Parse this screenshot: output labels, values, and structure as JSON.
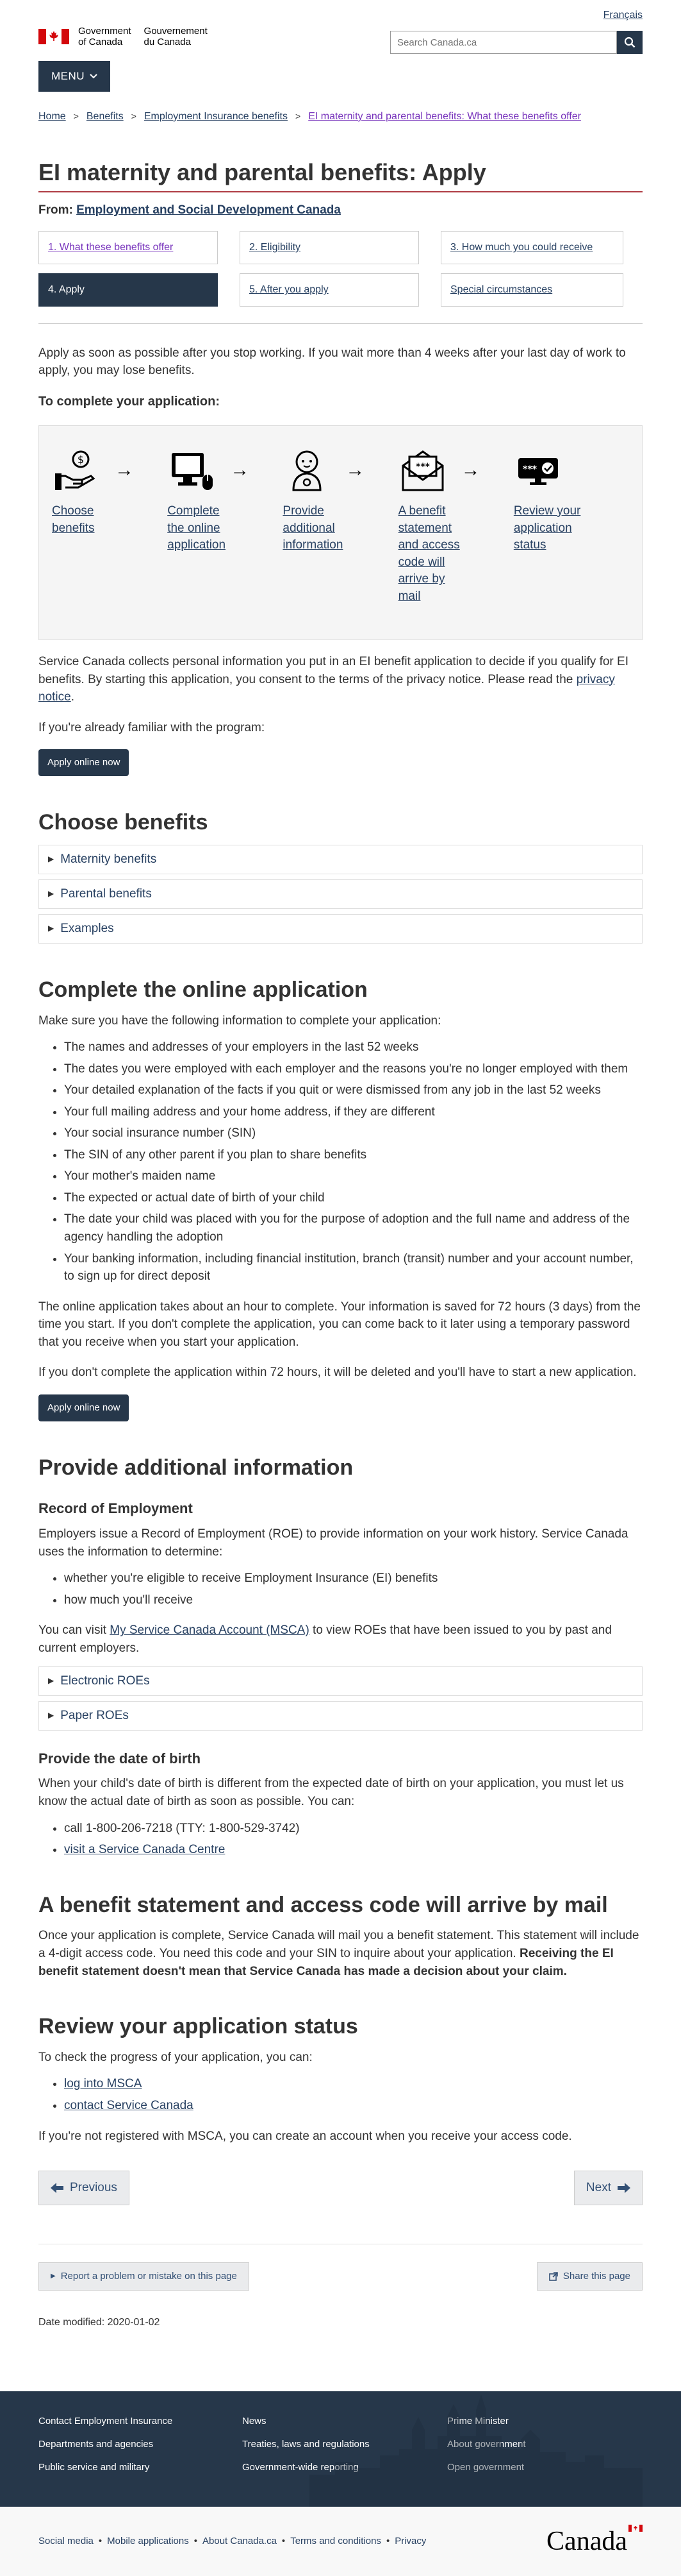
{
  "header": {
    "language_link": "Français",
    "sig_en_line1": "Government",
    "sig_en_line2": "of Canada",
    "sig_fr_line1": "Gouvernement",
    "sig_fr_line2": "du Canada",
    "search_placeholder": "Search Canada.ca",
    "menu_label": "MENU"
  },
  "breadcrumb": [
    "Home",
    "Benefits",
    "Employment Insurance benefits",
    "EI maternity and parental benefits: What these benefits offer"
  ],
  "page_title": "EI maternity and parental benefits: Apply",
  "from_label": "From: ",
  "from_link": "Employment and Social Development Canada",
  "steps": [
    {
      "label": "1. What these benefits offer",
      "active": false
    },
    {
      "label": "2. Eligibility",
      "active": false
    },
    {
      "label": "3. How much you could receive",
      "active": false
    },
    {
      "label": "4. Apply",
      "active": true
    },
    {
      "label": "5. After you apply",
      "active": false
    },
    {
      "label": "Special circumstances",
      "active": false
    }
  ],
  "intro": "Apply as soon as possible after you stop working. If you wait more than 4 weeks after your last day of work to apply, you may lose benefits.",
  "complete_heading": "To complete your application:",
  "process": [
    {
      "icon": "hand-coin-icon",
      "label": "Choose benefits"
    },
    {
      "icon": "computer-mouse-icon",
      "label": "Complete the online application"
    },
    {
      "icon": "baby-icon",
      "label": "Provide additional information"
    },
    {
      "icon": "envelope-icon",
      "label": "A benefit statement and access code will arrive by mail"
    },
    {
      "icon": "status-check-icon",
      "label": "Review your application status"
    }
  ],
  "privacy_text_1": "Service Canada collects personal information you put in an EI benefit application to decide if you qualify for EI benefits. By starting this application, you consent to the terms of the privacy notice. Please read the ",
  "privacy_link": "privacy notice",
  "privacy_text_2": ".",
  "familiar": "If you're already familiar with the program:",
  "apply_button": "Apply online now",
  "choose": {
    "heading": "Choose benefits",
    "items": [
      "Maternity benefits",
      "Parental benefits",
      "Examples"
    ]
  },
  "online": {
    "heading": "Complete the online application",
    "intro": "Make sure you have the following information to complete your application:",
    "list": [
      "The names and addresses of your employers in the last 52 weeks",
      "The dates you were employed with each employer and the reasons you're no longer employed with them",
      "Your detailed explanation of the facts if you quit or were dismissed from any job in the last 52 weeks",
      "Your full mailing address and your home address, if they are different",
      "Your social insurance number (SIN)",
      "The SIN of any other parent if you plan to share benefits",
      "Your mother's maiden name",
      "The expected or actual date of birth of your child",
      "The date your child was placed with you for the purpose of adoption and the full name and address of the agency handling the adoption",
      "Your banking information, including financial institution, branch (transit) number and your account number, to sign up for direct deposit"
    ],
    "para1": "The online application takes about an hour to complete. Your information is saved for 72 hours (3 days) from the time you start. If you don't complete the application, you can come back to it later using a temporary password that you receive when you start your application.",
    "para2": "If you don't complete the application within 72 hours, it will be deleted and you'll have to start a new application."
  },
  "additional": {
    "heading": "Provide additional information",
    "roe_heading": "Record of Employment",
    "roe_text": "Employers issue a Record of Employment (ROE) to provide information on your work history. Service Canada uses the information to determine:",
    "roe_list": [
      "whether you're eligible to receive Employment Insurance (EI) benefits",
      "how much you'll receive"
    ],
    "msca_1": "You can visit ",
    "msca_link": "My Service Canada Account (MSCA)",
    "msca_2": " to view ROEs that have been issued to you by past and current employers.",
    "roe_details": [
      "Electronic ROEs",
      "Paper ROEs"
    ],
    "dob_heading": "Provide the date of birth",
    "dob_text": "When your child's date of birth is different from the expected date of birth on your application, you must let us know the actual date of birth as soon as possible. You can:",
    "dob_call": "call 1-800-206-7218 (TTY: 1-800-529-3742)",
    "dob_visit": "visit a Service Canada Centre"
  },
  "mail": {
    "heading": "A benefit statement and access code will arrive by mail",
    "text": "Once your application is complete, Service Canada will mail you a benefit statement. This statement will include a 4-digit access code. You need this code and your SIN to inquire about your application.",
    "bold": "Receiving the EI benefit statement doesn't mean that Service Canada has made a decision about your claim."
  },
  "review": {
    "heading": "Review your application status",
    "intro": "To check the progress of your application, you can:",
    "links": [
      "log into MSCA",
      "contact Service Canada"
    ],
    "note": "If you're not registered with MSCA, you can create an account when you receive your access code."
  },
  "pager": {
    "previous": "Previous",
    "next": "Next"
  },
  "report_label": "Report a problem or mistake on this page",
  "share_label": "Share this page",
  "date_modified": "Date modified: 2020-01-02",
  "footer": {
    "links": [
      "Contact Employment Insurance",
      "News",
      "Prime Minister",
      "Departments and agencies",
      "Treaties, laws and regulations",
      "About government",
      "Public service and military",
      "Government-wide reporting",
      "Open government"
    ],
    "sub_links": [
      "Social media",
      "Mobile applications",
      "About Canada.ca",
      "Terms and conditions",
      "Privacy"
    ],
    "wordmark": "Canada"
  },
  "colors": {
    "accent": "#26374a",
    "title_rule": "#af3c43",
    "link": "#284162",
    "flag_red": "#d3080c"
  }
}
